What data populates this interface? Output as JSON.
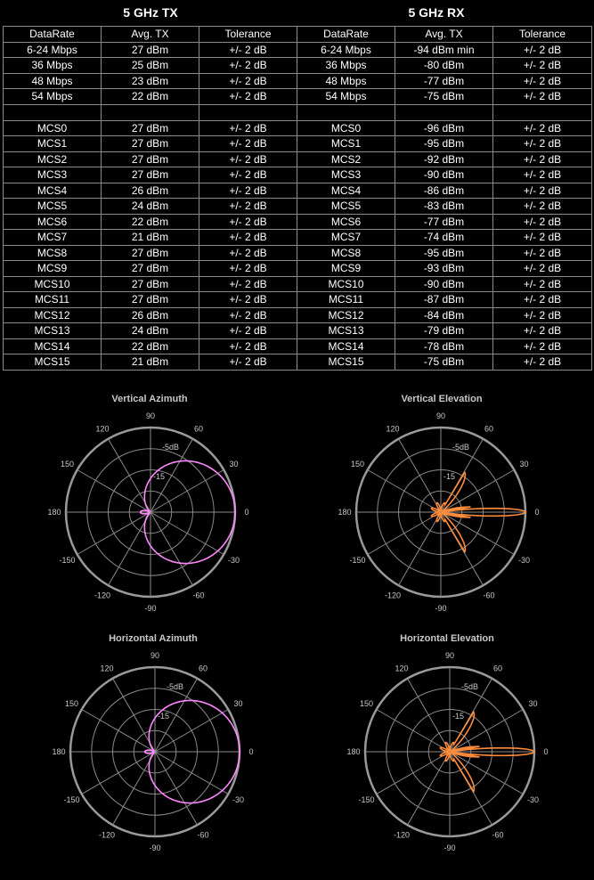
{
  "tx_header": "5 GHz TX",
  "rx_header": "5 GHz RX",
  "columns": [
    "DataRate",
    "Avg. TX",
    "Tolerance",
    "DataRate",
    "Avg. TX",
    "Tolerance"
  ],
  "rows": [
    [
      "6-24 Mbps",
      "27 dBm",
      "+/- 2 dB",
      "6-24 Mbps",
      "-94 dBm min",
      "+/- 2 dB"
    ],
    [
      "36 Mbps",
      "25 dBm",
      "+/- 2 dB",
      "36 Mbps",
      "-80 dBm",
      "+/- 2 dB"
    ],
    [
      "48 Mbps",
      "23 dBm",
      "+/- 2 dB",
      "48 Mbps",
      "-77 dBm",
      "+/- 2 dB"
    ],
    [
      "54 Mbps",
      "22 dBm",
      "+/- 2 dB",
      "54 Mbps",
      "-75 dBm",
      "+/- 2 dB"
    ],
    [
      "",
      "",
      "",
      "",
      "",
      ""
    ],
    [
      "MCS0",
      "27 dBm",
      "+/- 2 dB",
      "MCS0",
      "-96 dBm",
      "+/- 2 dB"
    ],
    [
      "MCS1",
      "27 dBm",
      "+/- 2 dB",
      "MCS1",
      "-95 dBm",
      "+/- 2 dB"
    ],
    [
      "MCS2",
      "27 dBm",
      "+/- 2 dB",
      "MCS2",
      "-92 dBm",
      "+/- 2 dB"
    ],
    [
      "MCS3",
      "27 dBm",
      "+/- 2 dB",
      "MCS3",
      "-90 dBm",
      "+/- 2 dB"
    ],
    [
      "MCS4",
      "26 dBm",
      "+/- 2 dB",
      "MCS4",
      "-86 dBm",
      "+/- 2 dB"
    ],
    [
      "MCS5",
      "24 dBm",
      "+/- 2 dB",
      "MCS5",
      "-83 dBm",
      "+/- 2 dB"
    ],
    [
      "MCS6",
      "22 dBm",
      "+/- 2 dB",
      "MCS6",
      "-77 dBm",
      "+/- 2 dB"
    ],
    [
      "MCS7",
      "21 dBm",
      "+/- 2 dB",
      "MCS7",
      "-74 dBm",
      "+/- 2 dB"
    ],
    [
      "MCS8",
      "27 dBm",
      "+/- 2 dB",
      "MCS8",
      "-95 dBm",
      "+/- 2 dB"
    ],
    [
      "MCS9",
      "27 dBm",
      "+/- 2 dB",
      "MCS9",
      "-93 dBm",
      "+/- 2 dB"
    ],
    [
      "MCS10",
      "27 dBm",
      "+/- 2 dB",
      "MCS10",
      "-90 dBm",
      "+/- 2 dB"
    ],
    [
      "MCS11",
      "27 dBm",
      "+/- 2 dB",
      "MCS11",
      "-87 dBm",
      "+/- 2 dB"
    ],
    [
      "MCS12",
      "26 dBm",
      "+/- 2 dB",
      "MCS12",
      "-84 dBm",
      "+/- 2 dB"
    ],
    [
      "MCS13",
      "24 dBm",
      "+/- 2 dB",
      "MCS13",
      "-79 dBm",
      "+/- 2 dB"
    ],
    [
      "MCS14",
      "22 dBm",
      "+/- 2 dB",
      "MCS14",
      "-78 dBm",
      "+/- 2 dB"
    ],
    [
      "MCS15",
      "21 dBm",
      "+/- 2 dB",
      "MCS15",
      "-75 dBm",
      "+/- 2 dB"
    ]
  ],
  "polar_plots": [
    {
      "title": "Vertical Azimuth",
      "color": "#ff88ff",
      "pattern": "azimuth"
    },
    {
      "title": "Vertical Elevation",
      "color": "#ff8c3a",
      "pattern": "elevation"
    },
    {
      "title": "Horizontal Azimuth",
      "color": "#ff88ff",
      "pattern": "azimuth"
    },
    {
      "title": "Horizontal Elevation",
      "color": "#ff8c3a",
      "pattern": "elevation"
    }
  ],
  "polar_labels": {
    "angles": [
      "0",
      "30",
      "60",
      "90",
      "120",
      "150",
      "180",
      "-150",
      "-120",
      "-90",
      "-60",
      "-30"
    ],
    "rings": [
      "-5dB",
      "-15"
    ]
  },
  "colors": {
    "background": "#000000",
    "grid": "#8a8a8a",
    "outer_ring": "#9a9a9a",
    "azimuth_trace": "#ff88ff",
    "elevation_trace": "#ff8c3a"
  }
}
